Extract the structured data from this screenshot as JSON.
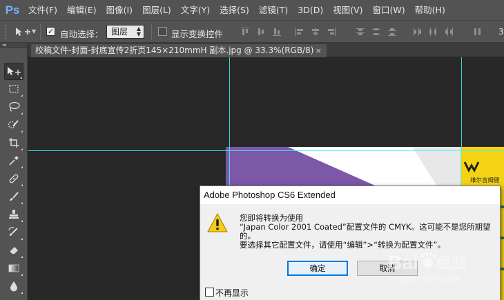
{
  "app": {
    "logo": "Ps"
  },
  "menu": [
    "文件(F)",
    "编辑(E)",
    "图像(I)",
    "图层(L)",
    "文字(Y)",
    "选择(S)",
    "滤镜(T)",
    "3D(D)",
    "视图(V)",
    "窗口(W)",
    "帮助(H)"
  ],
  "options_bar": {
    "tool_icon": "move-tool-icon",
    "auto_select_checked": true,
    "auto_select_label": "自动选择：",
    "target_value": "图层",
    "show_transform_checked": false,
    "show_transform_label": "显示变换控件",
    "trailing_text": "3"
  },
  "toolbar": {
    "header": "◂◂",
    "tools": [
      "move-tool",
      "marquee-tool",
      "lasso-tool",
      "quick-select-tool",
      "crop-tool",
      "eyedropper-tool",
      "healing-brush-tool",
      "brush-tool",
      "clone-stamp-tool",
      "history-brush-tool",
      "eraser-tool",
      "gradient-tool",
      "blur-tool"
    ],
    "active_tool": "move-tool"
  },
  "document": {
    "tab_title": "校稿文件-封面-封底宣传2折页145×210mmH 副本.jpg @ 33.3%(RGB/8)",
    "close_glyph": "×",
    "page_logo_text": "维尔吉姆健"
  },
  "colors": {
    "guide": "#3ff2ff",
    "page_purple": "#7b58a8",
    "page_yellow": "#f5d312",
    "accent_blue": "#0078d7"
  },
  "dialog": {
    "title": "Adobe Photoshop CS6 Extended",
    "icon": "warning-icon",
    "message_lines": [
      "您即将转换为使用",
      "“Japan Color 2001 Coated”配置文件的 CMYK。这可能不是您所期望",
      "的。",
      "要选择其它配置文件，请使用“编辑”>“转换为配置文件”。"
    ],
    "ok_label": "确定",
    "cancel_label": "取消",
    "dont_show_label": "不再显示",
    "dont_show_checked": false
  },
  "watermark": {
    "brand": "Bai",
    "brand_suffix": "经验",
    "url": "jingyan.baidu.com"
  }
}
